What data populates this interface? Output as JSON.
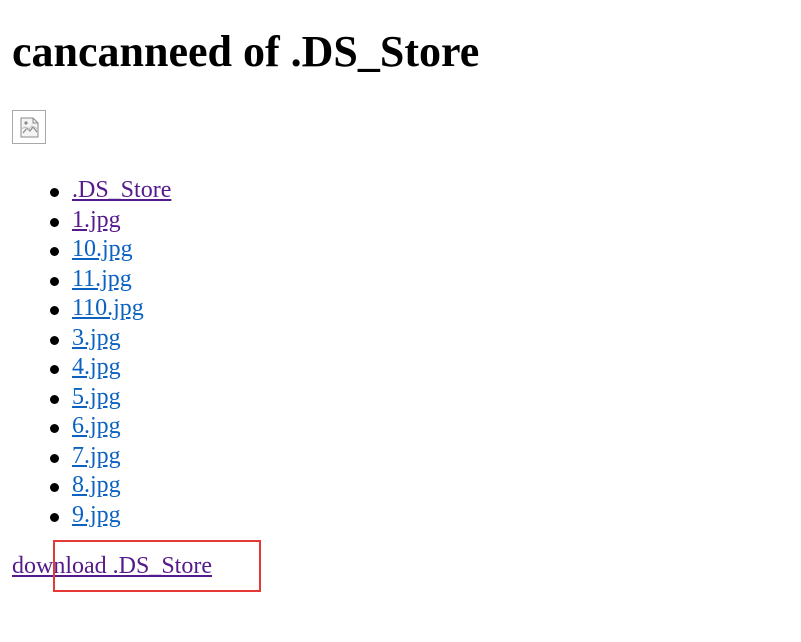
{
  "page": {
    "title": "cancanneed of .DS_Store",
    "image_icon": "broken-image-icon"
  },
  "files": [
    {
      "label": ".DS_Store",
      "visited": true
    },
    {
      "label": "1.jpg",
      "visited": true
    },
    {
      "label": "10.jpg",
      "visited": false
    },
    {
      "label": "11.jpg",
      "visited": false
    },
    {
      "label": "110.jpg",
      "visited": false
    },
    {
      "label": "3.jpg",
      "visited": false
    },
    {
      "label": "4.jpg",
      "visited": false
    },
    {
      "label": "5.jpg",
      "visited": false
    },
    {
      "label": "6.jpg",
      "visited": false
    },
    {
      "label": "7.jpg",
      "visited": false
    },
    {
      "label": "8.jpg",
      "visited": false
    },
    {
      "label": "9.jpg",
      "visited": false
    }
  ],
  "download": {
    "label": "download .DS_Store"
  },
  "colors": {
    "visited_link": "#551a8b",
    "unvisited_link": "#0b62c0",
    "highlight": "#e53935"
  }
}
